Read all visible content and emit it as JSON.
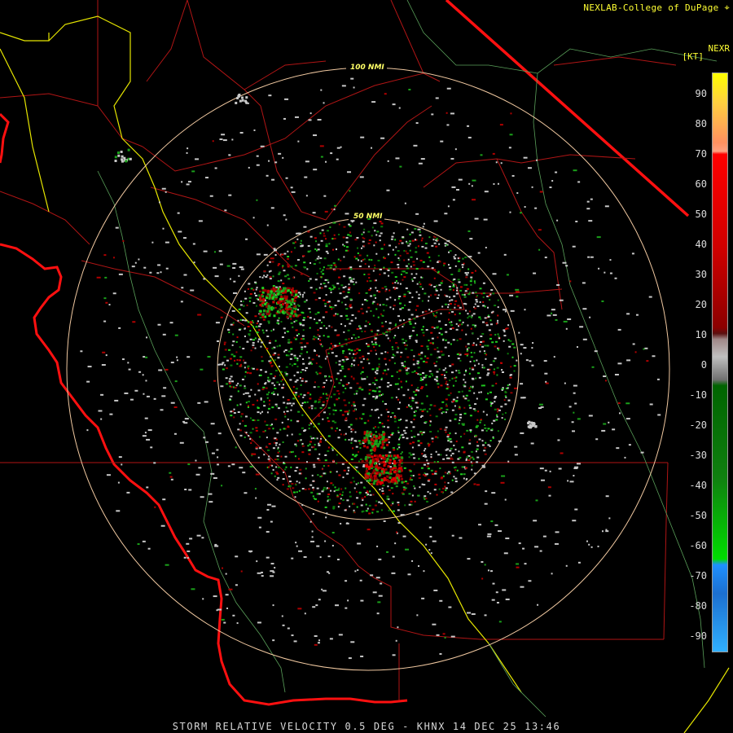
{
  "header": {
    "brand": "NEXLAB-College of DuPage",
    "product": "NEXR",
    "units": "[KT]"
  },
  "rings": {
    "inner_label": "50 NMI",
    "outer_label": "100 NMI"
  },
  "legend": {
    "ticks": [
      "90",
      "80",
      "70",
      "60",
      "50",
      "40",
      "30",
      "20",
      "10",
      "0",
      "-10",
      "-20",
      "-30",
      "-40",
      "-50",
      "-60",
      "-70",
      "-80",
      "-90"
    ],
    "colors": {
      "outbound_high": "#ffff00",
      "outbound_mid": "#ff0000",
      "outbound_low": "#8b0000",
      "zero": "#c0c0c0",
      "inbound_low": "#006400",
      "inbound_mid": "#00dd00",
      "inbound_high": "#1e90ff"
    }
  },
  "footer": {
    "caption": "STORM RELATIVE VELOCITY 0.5 DEG - KHNX 14 DEC 25 13:46"
  }
}
